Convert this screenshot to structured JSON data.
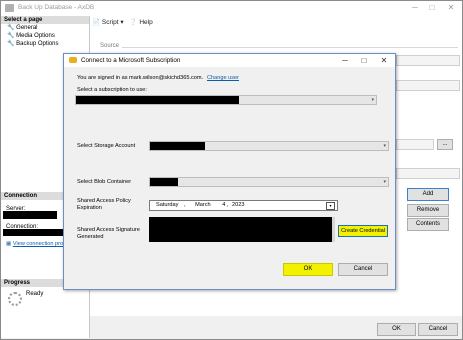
{
  "window": {
    "title": "Back Up Database - AxDB",
    "minimize_glyph": "─",
    "maximize_glyph": "□",
    "close_glyph": "✕"
  },
  "left_pane": {
    "select_page_header": "Select a page",
    "pages": [
      "General",
      "Media Options",
      "Backup Options"
    ],
    "connection_header": "Connection",
    "server_label": "Server:",
    "connection_label": "Connection:",
    "view_connection_link": "View connection prop",
    "progress_header": "Progress",
    "progress_status": "Ready"
  },
  "toolbar": {
    "script_label": "Script",
    "help_label": "Help"
  },
  "main": {
    "source_label": "Source",
    "add_label": "Add",
    "remove_label": "Remove",
    "contents_label": "Contents",
    "ellipsis_label": "...",
    "ok_label": "OK",
    "cancel_label": "Cancel"
  },
  "dialog": {
    "title": "Connect to a Microsoft Subscription",
    "signed_in_text": "You are signed in as mark.wilson@skichd365.com.",
    "change_user_link": "Change user",
    "select_subscription_label": "Select a subscription to use:",
    "storage_account_label": "Select Storage Account",
    "blob_container_label": "Select Blob Container",
    "policy_expiration_label": "Shared Access Policy Expiration",
    "date": {
      "weekday": "Saturday",
      "month": "March",
      "day": "4",
      "year": "2023"
    },
    "sas_label": "Shared Access Signature Generated",
    "create_credential_label": "Create Credential",
    "ok_label": "OK",
    "cancel_label": "Cancel"
  },
  "colors": {
    "highlight": "#f2f200",
    "link": "#0b5cad",
    "dialog_border": "#6a8fc7"
  }
}
